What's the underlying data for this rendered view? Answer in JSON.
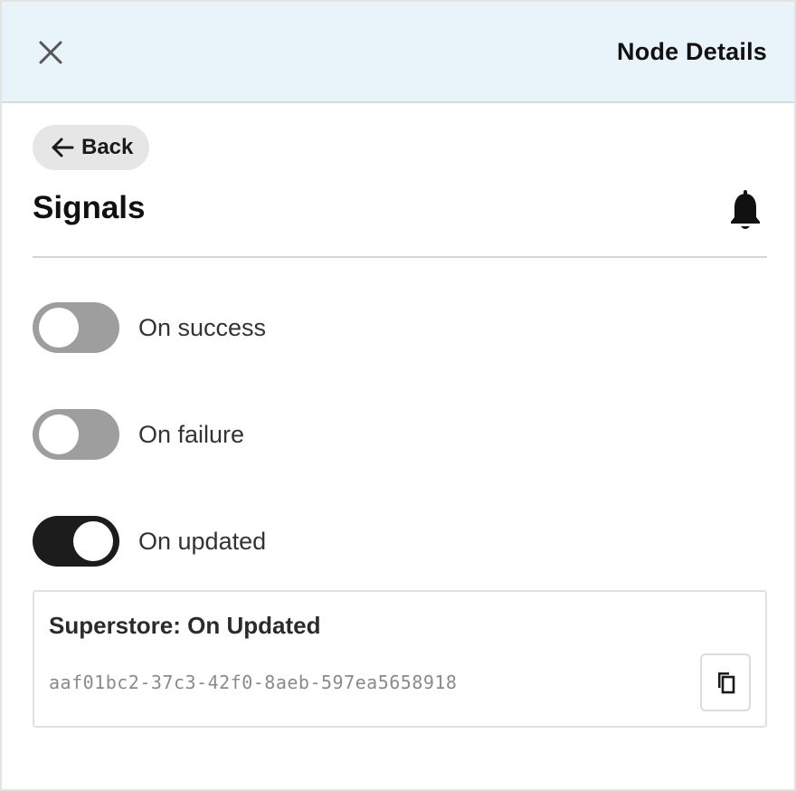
{
  "header": {
    "title": "Node Details",
    "close_icon": "close-icon"
  },
  "back": {
    "label": "Back",
    "icon": "arrow-left-icon"
  },
  "section": {
    "title": "Signals",
    "icon": "bell-icon"
  },
  "toggles": [
    {
      "label": "On success",
      "checked": false
    },
    {
      "label": "On failure",
      "checked": false
    },
    {
      "label": "On updated",
      "checked": true
    }
  ],
  "card": {
    "title": "Superstore: On Updated",
    "id": "aaf01bc2-37c3-42f0-8aeb-597ea5658918",
    "copy_icon": "copy-icon"
  },
  "colors": {
    "header_bg": "#e8f3fa",
    "toggle_off": "#9e9e9e",
    "toggle_on": "#1c1c1c"
  }
}
